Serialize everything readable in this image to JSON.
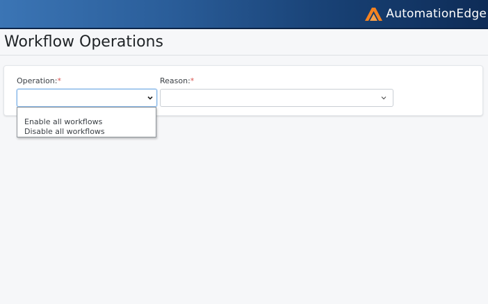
{
  "header": {
    "brand_text": "AutomationEdge",
    "logo_color": "#f58220"
  },
  "page": {
    "title": "Workflow Operations"
  },
  "form": {
    "operation": {
      "label": "Operation:",
      "required_mark": "*",
      "selected_value": "",
      "options": [
        "Enable all workflows",
        "Disable all workflows"
      ]
    },
    "reason": {
      "label": "Reason:",
      "required_mark": "*",
      "selected_value": ""
    }
  },
  "colors": {
    "required": "#d9534f",
    "focus_border": "#80b3e6"
  }
}
